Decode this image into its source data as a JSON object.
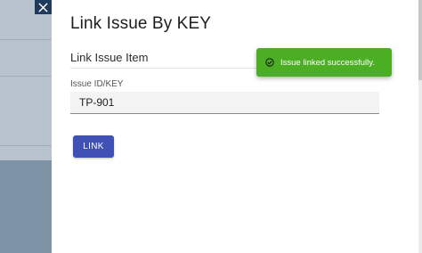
{
  "drawer": {
    "title": "Link Issue By KEY",
    "section_label": "Link Issue Item",
    "field": {
      "label": "Issue ID/KEY",
      "value": "TP-901"
    },
    "link_button_label": "LINK"
  },
  "toast": {
    "message": "Issue linked successfully.",
    "icon": "check-circle-icon",
    "color": "#4caf23"
  },
  "close_icon": "close-icon",
  "colors": {
    "primary": "#3f51b5",
    "success": "#4caf23",
    "close_bg": "#1f3b5c"
  }
}
